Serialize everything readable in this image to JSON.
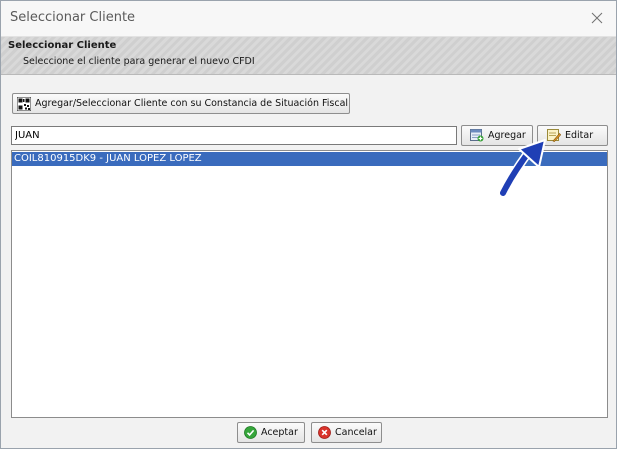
{
  "window": {
    "title": "Seleccionar Cliente",
    "close_icon": "close-icon"
  },
  "header": {
    "title": "Seleccionar Cliente",
    "subtitle": "Seleccione el cliente para generar el nuevo CFDI"
  },
  "toolbar": {
    "qr_button_label": "Agregar/Seleccionar Cliente con su Constancia de Situación Fiscal",
    "qr_icon": "qr-code-icon"
  },
  "search": {
    "value": "JUAN",
    "add_label": "Agregar",
    "add_icon": "add-client-icon",
    "edit_label": "Editar",
    "edit_icon": "edit-icon"
  },
  "clients": {
    "items": [
      {
        "label": "COIL810915DK9 - JUAN LOPEZ LOPEZ",
        "selected": true
      }
    ]
  },
  "footer": {
    "ok_label": "Aceptar",
    "ok_icon": "check-icon",
    "cancel_label": "Cancelar",
    "cancel_icon": "cancel-icon"
  },
  "colors": {
    "selection": "#3a6bbd",
    "annotation_arrow": "#1f3fb5"
  }
}
